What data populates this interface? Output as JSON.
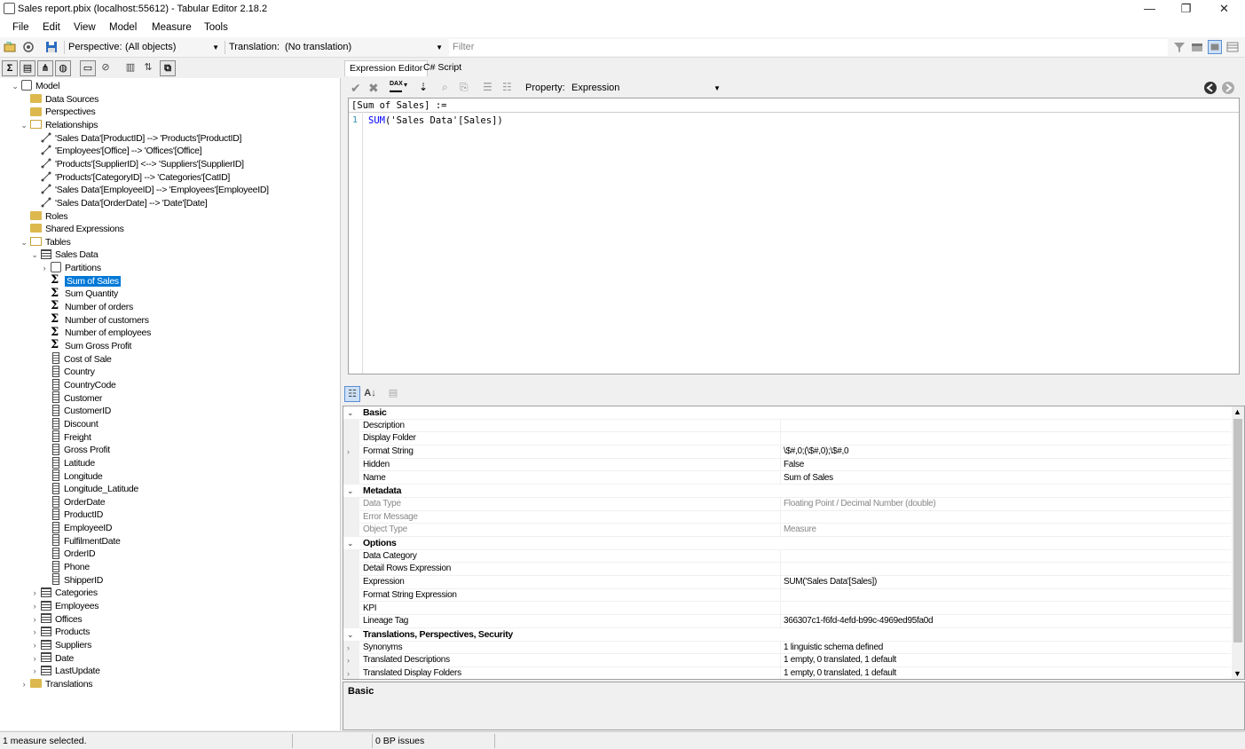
{
  "window": {
    "title": "Sales report.pbix (localhost:55612) - Tabular Editor 2.18.2",
    "minimize": "—",
    "maximize": "❐",
    "close": "✕"
  },
  "menu": [
    "File",
    "Edit",
    "View",
    "Model",
    "Measure",
    "Tools"
  ],
  "toolbar": {
    "perspective_label": "Perspective:",
    "perspective_value": "(All objects)",
    "translation_label": "Translation:",
    "translation_value": "(No translation)",
    "filter_placeholder": "Filter"
  },
  "tree": {
    "model": "Model",
    "data_sources": "Data Sources",
    "perspectives": "Perspectives",
    "relationships": "Relationships",
    "relationship_items": [
      "'Sales Data'[ProductID] --> 'Products'[ProductID]",
      "'Employees'[Office] --> 'Offices'[Office]",
      "'Products'[SupplierID] <--> 'Suppliers'[SupplierID]",
      "'Products'[CategoryID] --> 'Categories'[CatID]",
      "'Sales Data'[EmployeeID] --> 'Employees'[EmployeeID]",
      "'Sales Data'[OrderDate] --> 'Date'[Date]"
    ],
    "roles": "Roles",
    "shared_expressions": "Shared Expressions",
    "tables": "Tables",
    "sales_data": "Sales Data",
    "partitions": "Partitions",
    "measures": [
      "Sum of Sales",
      "Sum Quantity",
      "Number of orders",
      "Number of customers",
      "Number of employees",
      "Sum Gross Profit"
    ],
    "columns": [
      "Cost of Sale",
      "Country",
      "CountryCode",
      "Customer",
      "CustomerID",
      "Discount",
      "Freight",
      "Gross Profit",
      "Latitude",
      "Longitude",
      "Longitude_Latitude",
      "OrderDate",
      "ProductID",
      "EmployeeID",
      "FulfilmentDate",
      "OrderID",
      "Phone",
      "ShipperID"
    ],
    "other_tables": [
      "Categories",
      "Employees",
      "Offices",
      "Products",
      "Suppliers",
      "Date",
      "LastUpdate"
    ],
    "translations": "Translations"
  },
  "editor": {
    "tabs": [
      "Expression Editor",
      "C# Script"
    ],
    "property_label": "Property:",
    "property_value": "Expression",
    "header": "[Sum of Sales] :=",
    "line_number": "1",
    "code_fn": "SUM",
    "code_args": "('Sales Data'[Sales])"
  },
  "properties": [
    {
      "type": "cat",
      "name": "Basic"
    },
    {
      "type": "row",
      "name": "Description",
      "value": ""
    },
    {
      "type": "row",
      "name": "Display Folder",
      "value": ""
    },
    {
      "type": "row",
      "name": "Format String",
      "value": "\\$#,0;(\\$#,0);\\$#,0",
      "expandable": true
    },
    {
      "type": "row",
      "name": "Hidden",
      "value": "False"
    },
    {
      "type": "row",
      "name": "Name",
      "value": "Sum of Sales"
    },
    {
      "type": "cat",
      "name": "Metadata"
    },
    {
      "type": "row",
      "name": "Data Type",
      "value": "Floating Point / Decimal Number (double)",
      "readonly": true
    },
    {
      "type": "row",
      "name": "Error Message",
      "value": "",
      "readonly": true
    },
    {
      "type": "row",
      "name": "Object Type",
      "value": "Measure",
      "readonly": true
    },
    {
      "type": "cat",
      "name": "Options"
    },
    {
      "type": "row",
      "name": "Data Category",
      "value": ""
    },
    {
      "type": "row",
      "name": "Detail Rows Expression",
      "value": ""
    },
    {
      "type": "row",
      "name": "Expression",
      "value": "SUM('Sales Data'[Sales])"
    },
    {
      "type": "row",
      "name": "Format String Expression",
      "value": ""
    },
    {
      "type": "row",
      "name": "KPI",
      "value": ""
    },
    {
      "type": "row",
      "name": "Lineage Tag",
      "value": "366307c1-f6fd-4efd-b99c-4969ed95fa0d"
    },
    {
      "type": "cat",
      "name": "Translations, Perspectives, Security"
    },
    {
      "type": "row",
      "name": "Synonyms",
      "value": "1 linguistic schema defined",
      "expandable": true
    },
    {
      "type": "row",
      "name": "Translated Descriptions",
      "value": "1 empty, 0 translated, 1 default",
      "expandable": true
    },
    {
      "type": "row",
      "name": "Translated Display Folders",
      "value": "1 empty, 0 translated, 1 default",
      "expandable": true
    }
  ],
  "description_panel": "Basic",
  "status": {
    "selection": "1 measure selected.",
    "bp_issues": "0 BP issues"
  },
  "colors": {
    "selection": "#0078d7",
    "folder": "#dcb84e",
    "code_function": "#0000ff"
  }
}
